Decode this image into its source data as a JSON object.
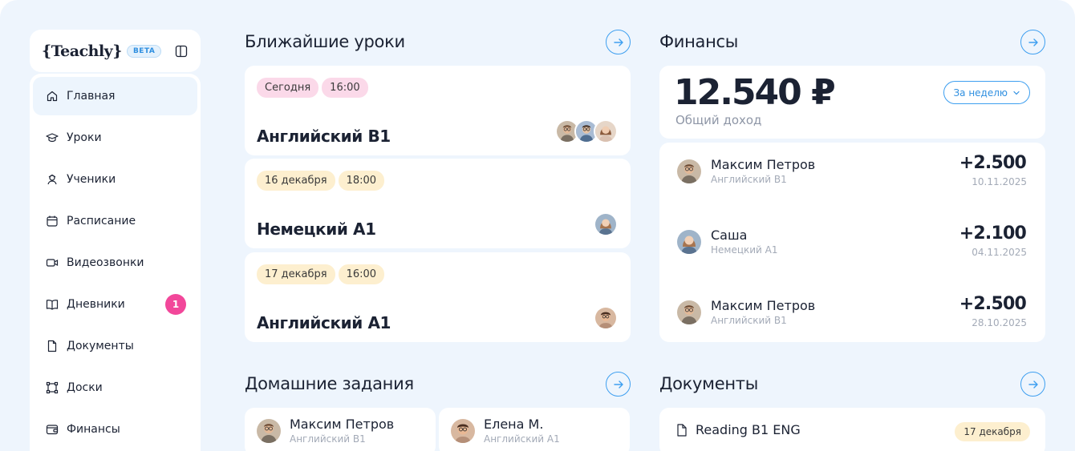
{
  "brand": {
    "logo": "{Teachly}",
    "badge": "BETA"
  },
  "nav": [
    {
      "label": "Главная",
      "icon": "home-icon",
      "active": true
    },
    {
      "label": "Уроки",
      "icon": "graduation-cap-icon"
    },
    {
      "label": "Ученики",
      "icon": "students-icon"
    },
    {
      "label": "Расписание",
      "icon": "calendar-icon"
    },
    {
      "label": "Видеозвонки",
      "icon": "video-icon"
    },
    {
      "label": "Дневники",
      "icon": "book-icon",
      "badge": "1"
    },
    {
      "label": "Документы",
      "icon": "document-icon"
    },
    {
      "label": "Доски",
      "icon": "board-icon"
    },
    {
      "label": "Финансы",
      "icon": "wallet-icon"
    }
  ],
  "lessons": {
    "title": "Ближайшие уроки",
    "items": [
      {
        "date": "Сегодня",
        "time": "16:00",
        "title": "Английский B1",
        "avatars": 3
      },
      {
        "date": "16 декабря",
        "time": "18:00",
        "title": "Немецкий A1",
        "avatars": 1
      },
      {
        "date": "17 декабря",
        "time": "16:00",
        "title": "Английский A1",
        "avatars": 1
      }
    ]
  },
  "finance": {
    "title": "Финансы",
    "amount": "12.540 ₽",
    "subtitle": "Общий доход",
    "period": "За неделю",
    "transactions": [
      {
        "name": "Максим Петров",
        "course": "Английский B1",
        "amount": "+2.500",
        "date": "10.11.2025"
      },
      {
        "name": "Саша",
        "course": "Немецкий A1",
        "amount": "+2.100",
        "date": "04.11.2025"
      },
      {
        "name": "Максим Петров",
        "course": "Английский B1",
        "amount": "+2.500",
        "date": "28.10.2025"
      }
    ]
  },
  "homework": {
    "title": "Домашние задания",
    "items": [
      {
        "name": "Максим Петров",
        "course": "Английский B1"
      },
      {
        "name": "Елена М.",
        "course": "Английский A1"
      }
    ]
  },
  "documents": {
    "title": "Документы",
    "items": [
      {
        "name": "Reading B1 ENG",
        "date": "17 декабря"
      }
    ]
  },
  "colors": {
    "accent": "#3e9ff0",
    "badge": "#f2479a",
    "pink_chip": "#fbd9e9",
    "yellow_chip": "#fdefcf",
    "background": "#eef5fd"
  }
}
